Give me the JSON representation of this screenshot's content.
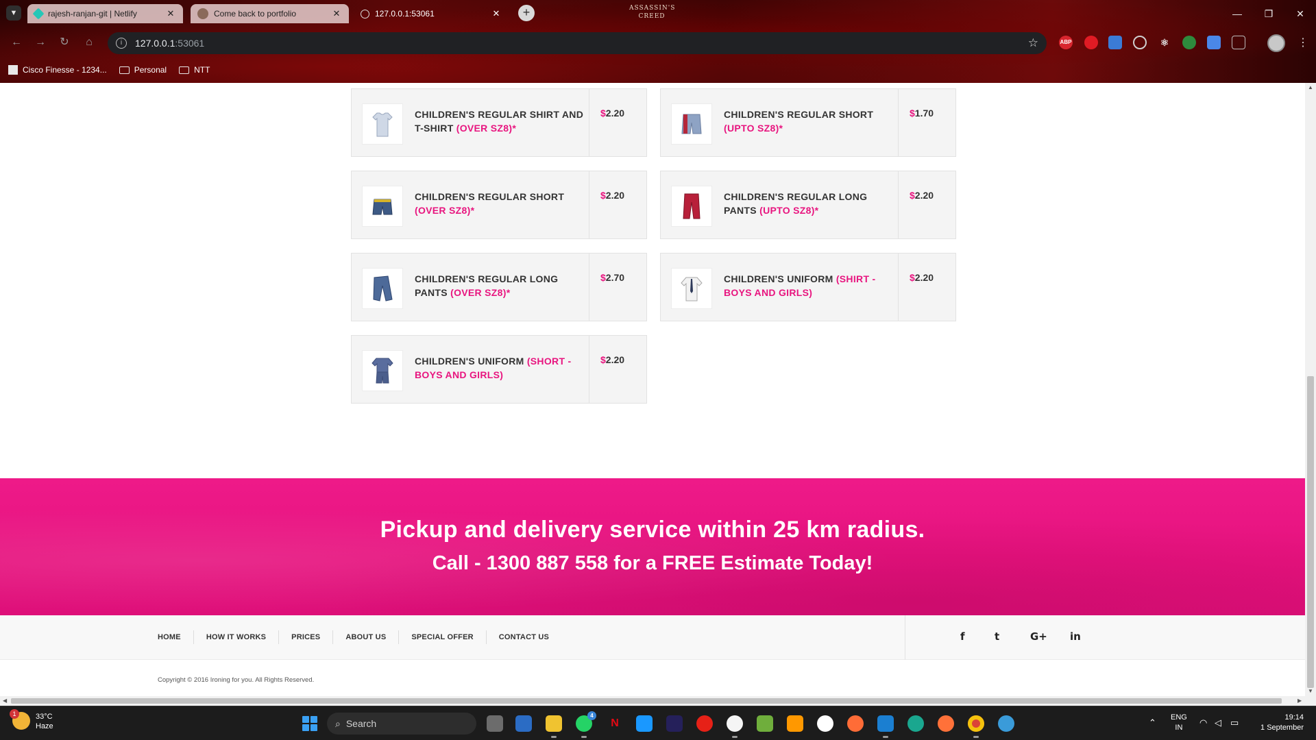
{
  "browser": {
    "tabs": [
      {
        "title": "rajesh-ranjan-git | Netlify",
        "favicon": "netlify-icon"
      },
      {
        "title": "Come back to portfolio",
        "favicon": "avatar-icon"
      },
      {
        "title": "127.0.0.1:53061",
        "favicon": "globe-icon"
      }
    ],
    "theme_logo": "ASSASSIN'S CREED",
    "address": {
      "host": "127.0.0.1",
      "port": ":53061"
    },
    "bookmarks": [
      {
        "label": "Cisco Finesse - 1234...",
        "icon": "cisco-icon"
      },
      {
        "label": "Personal",
        "icon": "folder-icon"
      },
      {
        "label": "NTT",
        "icon": "folder-icon"
      }
    ],
    "extensions": [
      "ABP"
    ]
  },
  "prices": [
    {
      "name": "CHILDREN'S REGULAR SHIRT AND T-SHIRT",
      "qualifier": "(OVER SZ8)*",
      "currency": "$",
      "amount": "2.20",
      "icon": "shirt-icon"
    },
    {
      "name": "CHILDREN'S REGULAR SHORT",
      "qualifier": "(UPTO SZ8)*",
      "currency": "$",
      "amount": "1.70",
      "icon": "shorts-icon"
    },
    {
      "name": "CHILDREN'S REGULAR SHORT",
      "qualifier": "(OVER SZ8)*",
      "currency": "$",
      "amount": "2.20",
      "icon": "shorts-icon"
    },
    {
      "name": "CHILDREN'S REGULAR LONG PANTS",
      "qualifier": "(UPTO SZ8)*",
      "currency": "$",
      "amount": "2.20",
      "icon": "pants-icon"
    },
    {
      "name": "CHILDREN'S REGULAR LONG PANTS",
      "qualifier": "(OVER SZ8)*",
      "currency": "$",
      "amount": "2.70",
      "icon": "pants-icon"
    },
    {
      "name": "CHILDREN'S UNIFORM",
      "qualifier": "(SHIRT - BOYS AND GIRLS)",
      "currency": "$",
      "amount": "2.20",
      "icon": "uniform-shirt-icon"
    },
    {
      "name": "CHILDREN'S UNIFORM",
      "qualifier": "(SHORT - BOYS AND GIRLS)",
      "currency": "$",
      "amount": "2.20",
      "icon": "uniform-short-icon"
    }
  ],
  "banner": {
    "line1": "Pickup and delivery service within 25 km radius.",
    "line2": "Call - 1300 887 558 for a FREE Estimate Today!"
  },
  "footer": {
    "nav": [
      "HOME",
      "HOW IT WORKS",
      "PRICES",
      "ABOUT US",
      "SPECIAL OFFER",
      "CONTACT US"
    ],
    "social": [
      "f",
      "t",
      "G+",
      "in"
    ],
    "copyright": "Copyright © 2016 Ironing for you. All Rights Reserved."
  },
  "taskbar": {
    "weather": {
      "temp": "33°C",
      "condition": "Haze",
      "badge": "1"
    },
    "search_label": "Search",
    "whatsapp_badge": "4",
    "tray": {
      "lang": "ENG",
      "region": "IN",
      "time": "19:14",
      "date": "1 September"
    }
  },
  "colors": {
    "accent": "#e8157f",
    "banner": "#ec1887",
    "text": "#333333"
  }
}
